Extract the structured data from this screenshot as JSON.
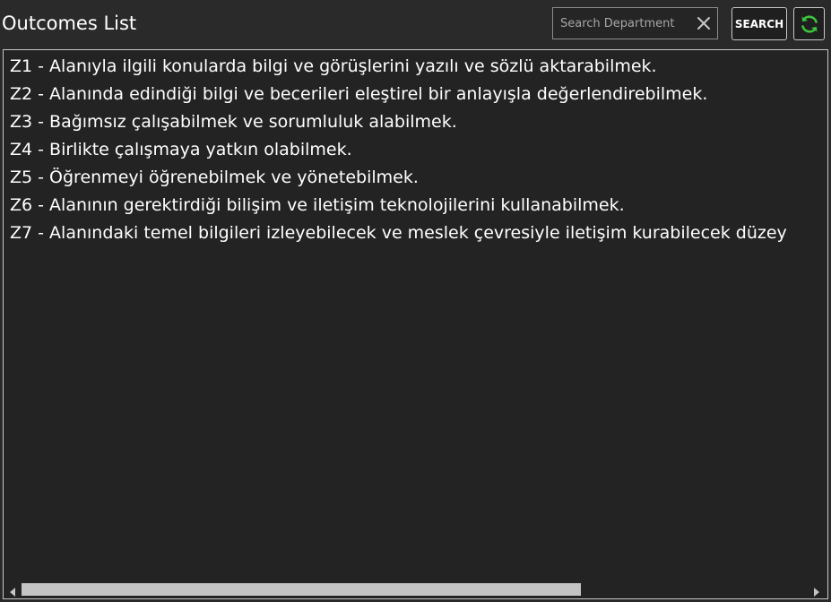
{
  "window": {
    "title": "Outcomes List"
  },
  "search": {
    "placeholder": "Search Department",
    "value": "",
    "button_label": "SEARCH",
    "clear_icon": "close-icon",
    "refresh_icon": "refresh-icon"
  },
  "outcomes": {
    "items": [
      "Z1 - Alanıyla ilgili konularda bilgi ve görüşlerini yazılı ve sözlü aktarabilmek.",
      "Z2 - Alanında edindiği bilgi ve becerileri eleştirel bir anlayışla değerlendirebilmek.",
      "Z3 - Bağımsız çalışabilmek ve sorumluluk alabilmek.",
      "Z4 - Birlikte çalışmaya yatkın olabilmek.",
      "Z5 - Öğrenmeyi öğrenebilmek ve yönetebilmek.",
      "Z6 - Alanının gerektirdiği bilişim ve iletişim teknolojilerini kullanabilmek.",
      "Z7 - Alanındaki temel bilgileri izleyebilecek ve meslek çevresiyle iletişim kurabilecek düzey"
    ]
  },
  "scrollbar": {
    "visible_fraction": 0.71,
    "position_fraction": 0.0
  },
  "colors": {
    "background": "#2a2a2a",
    "refresh_icon": "#3cc43c",
    "scroll_thumb": "#c4c4c4"
  }
}
